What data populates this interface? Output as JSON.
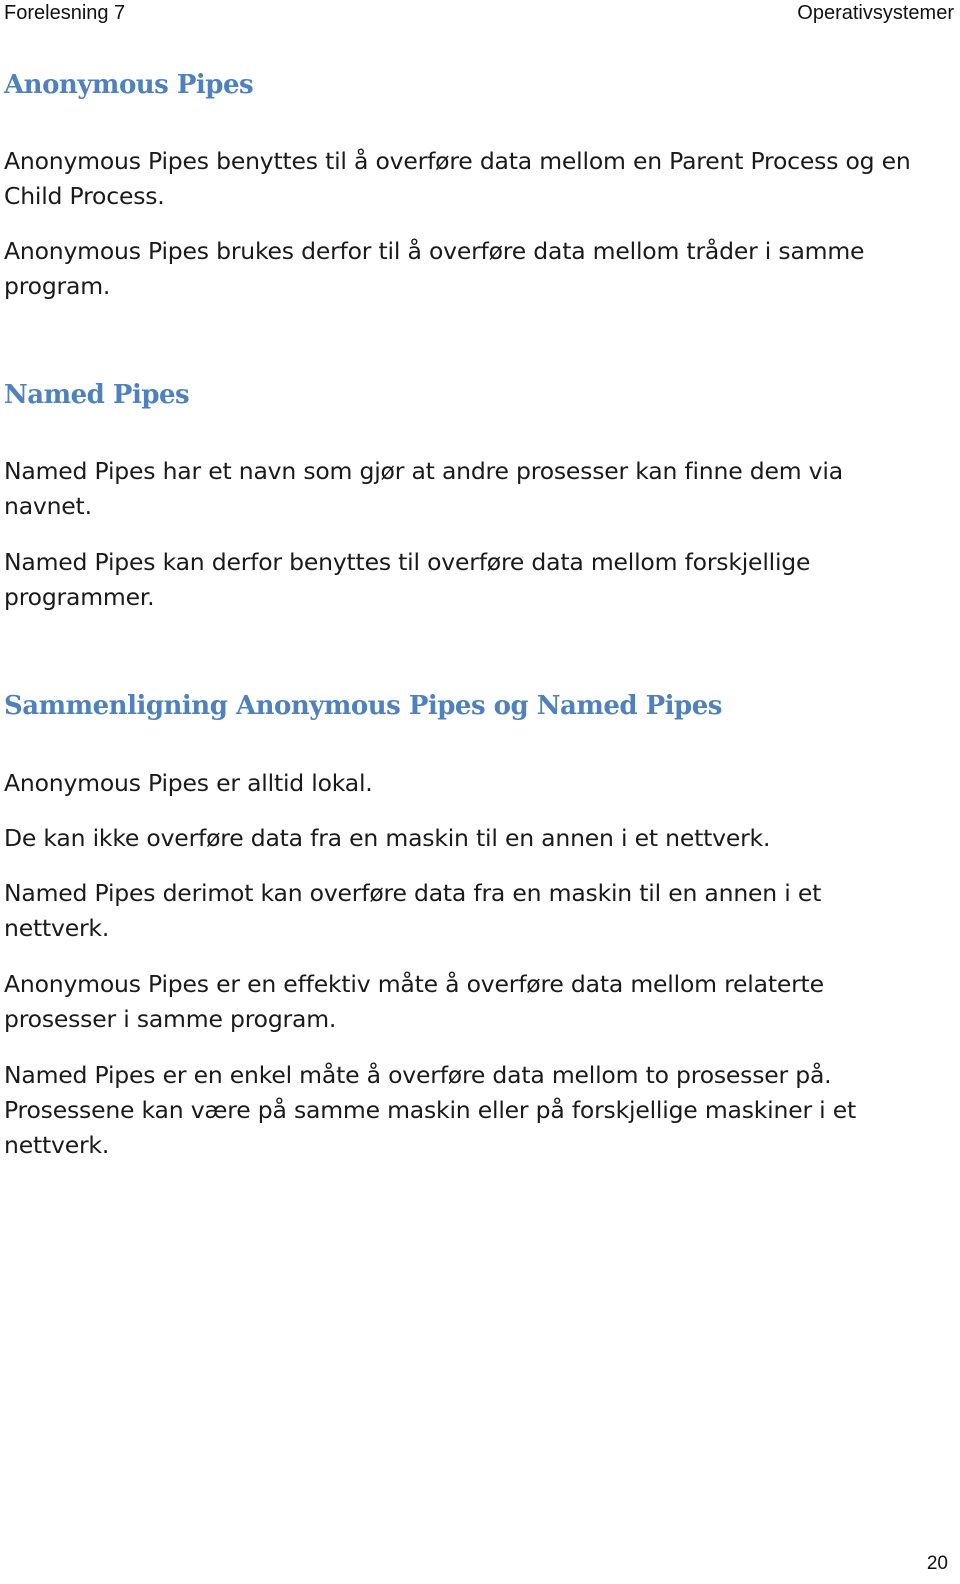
{
  "header": {
    "left": "Forelesning 7",
    "right": "Operativsystemer"
  },
  "sections": [
    {
      "heading": "Anonymous Pipes",
      "paragraphs": [
        "Anonymous Pipes benyttes til å overføre data mellom en Parent Process og en Child Process.",
        "Anonymous Pipes brukes derfor til å overføre data mellom tråder i samme program."
      ]
    },
    {
      "heading": "Named Pipes",
      "paragraphs": [
        "Named Pipes har et navn som gjør at andre prosesser kan finne dem via navnet.",
        "Named Pipes kan derfor benyttes til overføre data mellom forskjellige programmer."
      ]
    },
    {
      "heading": "Sammenligning Anonymous Pipes og Named Pipes",
      "paragraphs": [
        "Anonymous Pipes er alltid lokal.",
        "De kan ikke overføre data fra en maskin til en annen i et nettverk.",
        "Named Pipes derimot kan overføre data fra en maskin til en annen i et nettverk.",
        "Anonymous Pipes er en effektiv måte å overføre data mellom relaterte prosesser i samme program.",
        "Named Pipes er en enkel måte å overføre data mellom to prosesser på. Prosessene kan være på samme maskin eller på forskjellige maskiner i et nettverk."
      ]
    }
  ],
  "footer": {
    "page_number": "20"
  },
  "colors": {
    "heading": "#4f81bd",
    "text": "#1a1a1a"
  }
}
